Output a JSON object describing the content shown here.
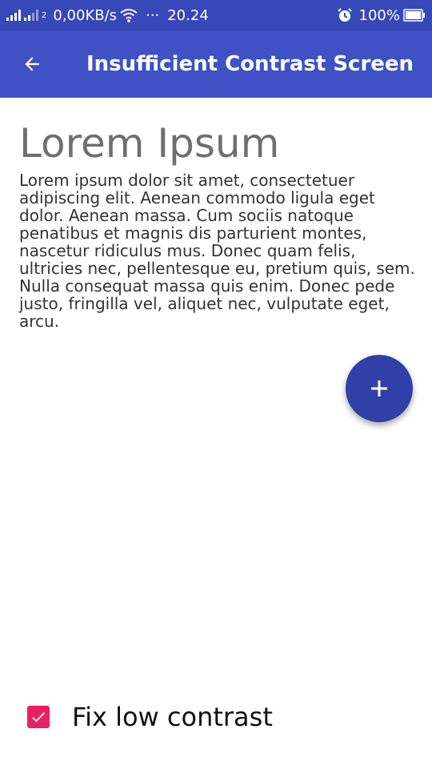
{
  "status_bar": {
    "sim2_label": "2",
    "network_speed": "0,00KB/s",
    "more_indicator": "···",
    "time": "20.24",
    "battery_percent": "100%"
  },
  "app_bar": {
    "title": "Insufficient Contrast Screen"
  },
  "main": {
    "heading": "Lorem Ipsum",
    "body": "Lorem ipsum dolor sit amet, consectetuer adipiscing elit. Aenean commodo ligula eget dolor. Aenean massa. Cum sociis natoque penatibus et magnis dis parturient montes, nascetur ridiculus mus. Donec quam felis, ultricies nec, pellentesque eu, pretium quis, sem. Nulla consequat massa quis enim. Donec pede justo, fringilla vel, aliquet nec, vulputate eget, arcu."
  },
  "fab": {
    "icon": "plus-icon"
  },
  "fix_contrast": {
    "label": "Fix low contrast",
    "checked": true
  },
  "colors": {
    "status_bar": "#3748b8",
    "app_bar": "#3f51c5",
    "fab": "#3040a8",
    "checkbox": "#e91e63",
    "heading": "#6f6f6f"
  }
}
